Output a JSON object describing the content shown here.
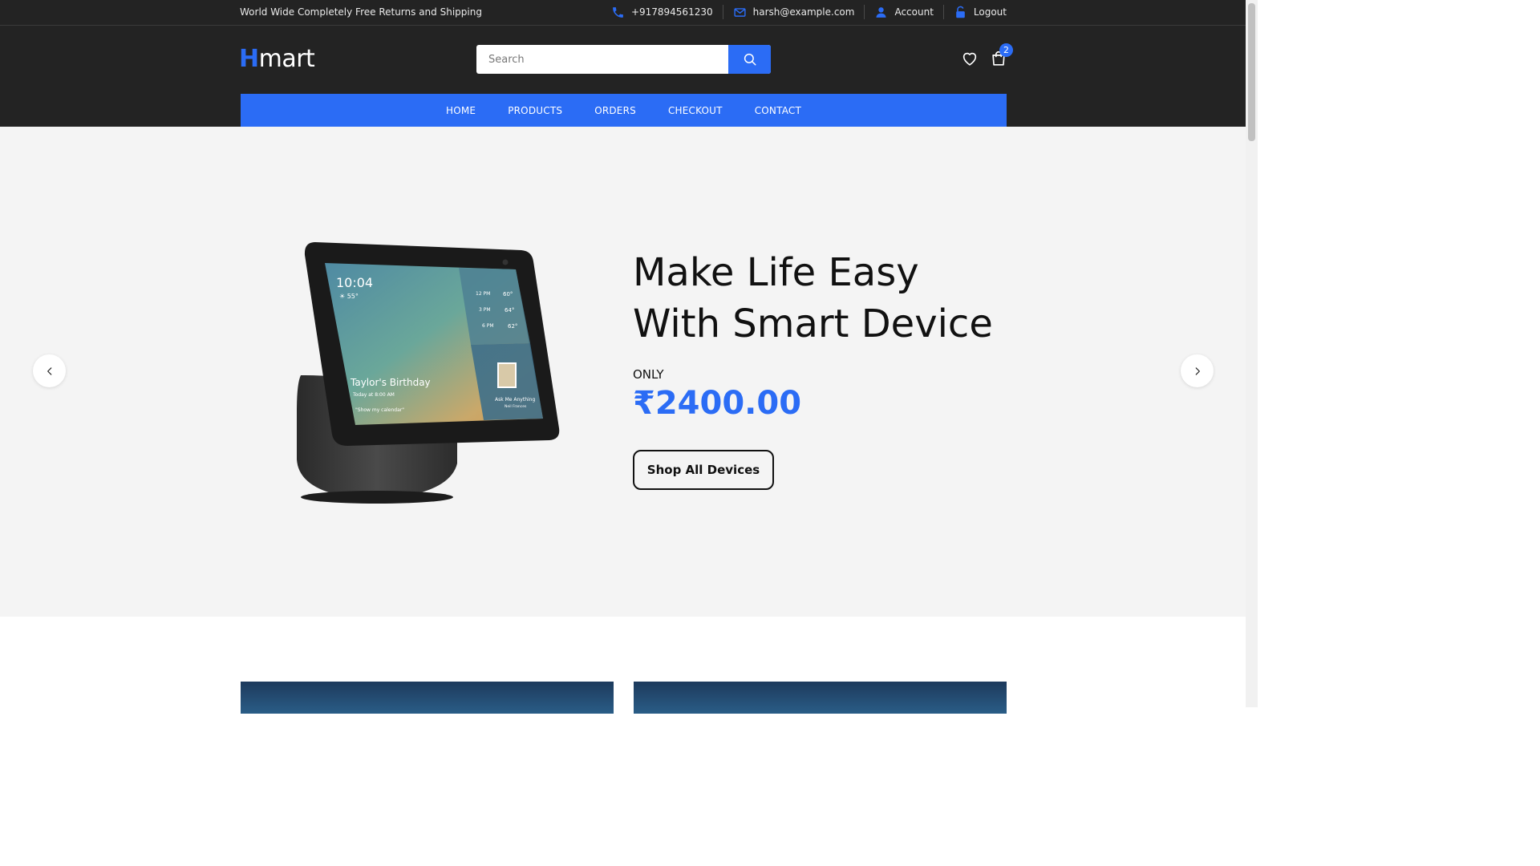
{
  "topbar": {
    "promo": "World Wide Completely Free Returns and Shipping",
    "phone": "+917894561230",
    "email": "harsh@example.com",
    "account": "Account",
    "logout": "Logout"
  },
  "header": {
    "logo_first": "H",
    "logo_rest": "mart",
    "search_placeholder": "Search",
    "cart_count": "2"
  },
  "nav": {
    "items": [
      "HOME",
      "PRODUCTS",
      "ORDERS",
      "CHECKOUT",
      "CONTACT"
    ]
  },
  "hero": {
    "title_line1": "Make Life Easy",
    "title_line2": "With Smart Device",
    "only": "ONLY",
    "price": "₹2400.00",
    "cta": "Shop All Devices",
    "screen": {
      "time": "10:04",
      "temp": "☀ 55°",
      "event": "Taylor's Birthday",
      "event_time": "Today at 8:00 AM",
      "event_hint": "\"Show my calendar\"",
      "forecast": [
        {
          "time": "12 PM",
          "temp": "60°"
        },
        {
          "time": "3 PM",
          "temp": "64°"
        },
        {
          "time": "6 PM",
          "temp": "62°"
        }
      ],
      "ask": "Ask Me Anything",
      "ask_sub": "Neil Frances"
    }
  },
  "colors": {
    "accent": "#2b6cf5",
    "dark": "#232323",
    "hero_bg": "#f4f4f4"
  }
}
